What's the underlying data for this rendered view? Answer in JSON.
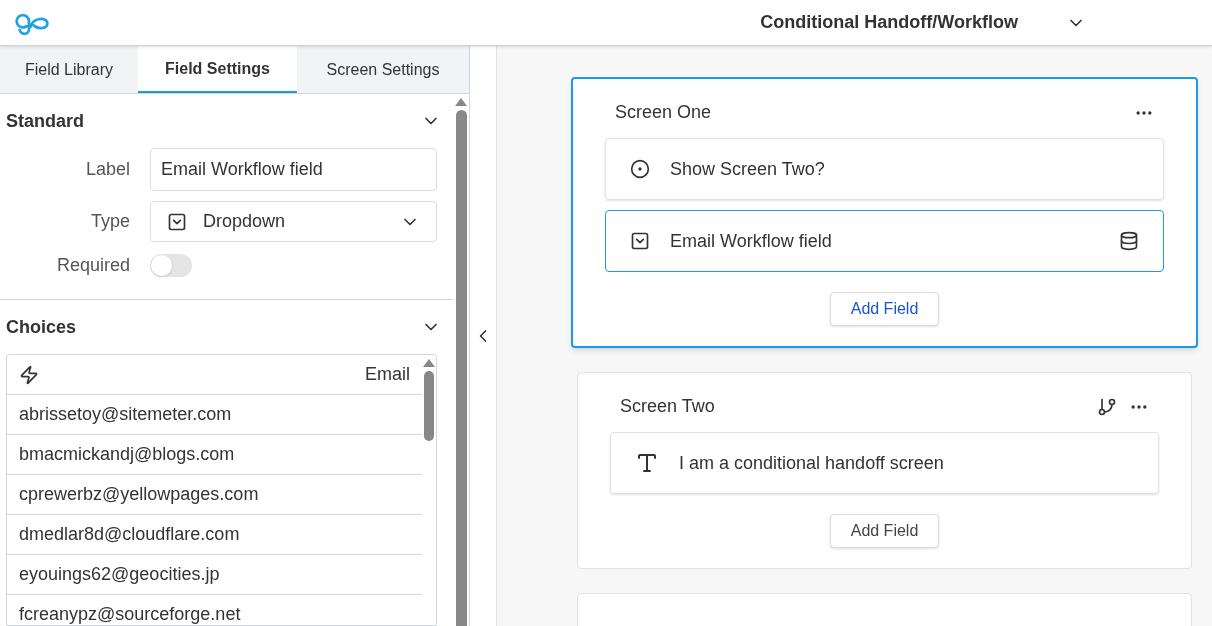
{
  "header": {
    "title": "Conditional Handoff/Workflow"
  },
  "tabs": [
    {
      "label": "Field Library",
      "selected": false
    },
    {
      "label": "Field Settings",
      "selected": true
    },
    {
      "label": "Screen Settings",
      "selected": false
    }
  ],
  "standard": {
    "title": "Standard",
    "label_caption": "Label",
    "label_value": "Email Workflow field",
    "type_caption": "Type",
    "type_value": "Dropdown",
    "required_caption": "Required",
    "required_on": false
  },
  "choices": {
    "title": "Choices",
    "column": "Email",
    "rows": [
      "abrissetoy@sitemeter.com",
      "bmacmickandj@blogs.com",
      "cprewerbz@yellowpages.com",
      "dmedlar8d@cloudflare.com",
      "eyouings62@geocities.jp",
      "fcreanypz@sourceforge.net"
    ]
  },
  "screens": [
    {
      "title": "Screen One",
      "selected": true,
      "branch": false,
      "add_label": "Add Field",
      "fields": [
        {
          "kind": "radio",
          "label": "Show Screen Two?",
          "selected": false,
          "data_source": false
        },
        {
          "kind": "dropdown",
          "label": "Email Workflow field",
          "selected": true,
          "data_source": true
        }
      ]
    },
    {
      "title": "Screen Two",
      "selected": false,
      "branch": true,
      "add_label": "Add Field",
      "fields": [
        {
          "kind": "text",
          "label": "I am a conditional handoff screen",
          "selected": false,
          "data_source": false
        }
      ]
    }
  ]
}
